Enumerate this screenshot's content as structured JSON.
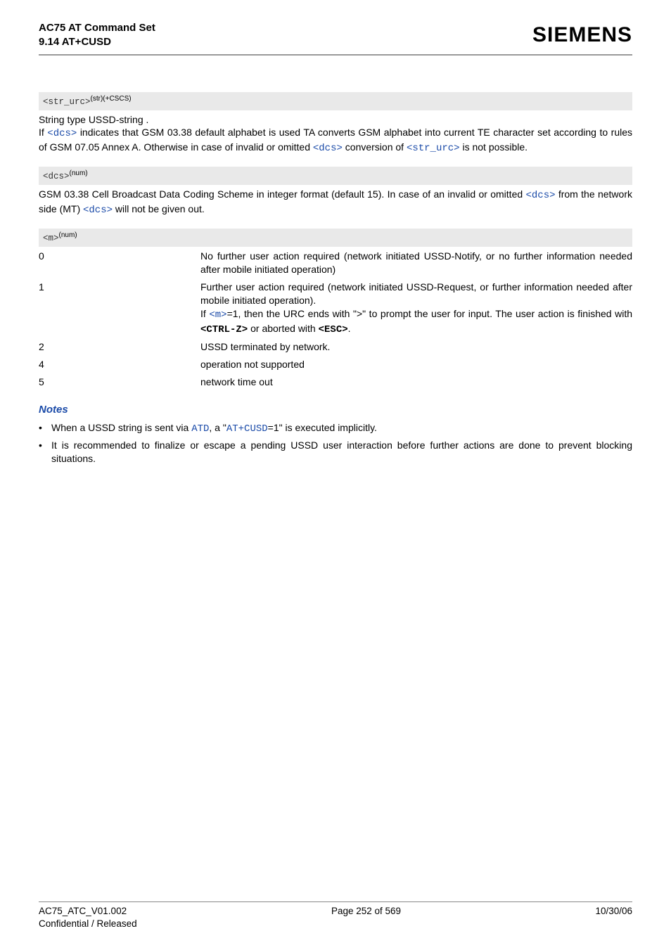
{
  "header": {
    "title_line1": "AC75 AT Command Set",
    "title_line2": "9.14 AT+CUSD",
    "brand": "SIEMENS"
  },
  "params": {
    "str_urc": {
      "code": "<str_urc>",
      "sup": "(str)(+CSCS)",
      "desc_pre": "String type USSD-string .",
      "desc_p1a": "If ",
      "dcs1": "<dcs>",
      "desc_p1b": " indicates that GSM 03.38 default alphabet is used TA converts GSM alphabet into current TE character set according to rules of GSM 07.05 Annex A. Otherwise in case of invalid or omitted ",
      "dcs2": "<dcs>",
      "desc_p1c": " conversion of ",
      "str_urc_ref": "<str_urc>",
      "desc_p1d": " is not possible."
    },
    "dcs": {
      "code": "<dcs>",
      "sup": "(num)",
      "desc_a": "GSM 03.38 Cell Broadcast Data Coding Scheme in integer format (default 15). In case of an invalid or omitted ",
      "dcs1": "<dcs>",
      "desc_b": " from the network side (MT) ",
      "dcs2": "<dcs>",
      "desc_c": " will not be given out."
    },
    "m": {
      "code": "<m>",
      "sup": "(num)",
      "rows": [
        {
          "key": "0",
          "val": "No further user action required (network initiated USSD-Notify, or no further information needed after mobile initiated operation)"
        },
        {
          "key": "1",
          "val_a": "Further user action required (network initiated USSD-Request, or further information needed after mobile initiated operation).",
          "val_b_pre": "If ",
          "m_ref": "<m>",
          "val_b_post": "=1, then the URC ends with \">\" to prompt the user for input. The user action is finished with ",
          "ctrlz": "<CTRL-Z>",
          "val_b_mid": " or aborted with ",
          "esc": "<ESC>",
          "val_b_end": "."
        },
        {
          "key": "2",
          "val": "USSD terminated by network."
        },
        {
          "key": "4",
          "val": "operation not supported"
        },
        {
          "key": "5",
          "val": "network time out"
        }
      ]
    }
  },
  "notes": {
    "heading": "Notes",
    "n1_a": "When a USSD string is sent via ",
    "atd": "ATD",
    "n1_b": ", a \"",
    "atcusd": "AT+CUSD",
    "n1_c": "=1\" is executed implicitly.",
    "n2": "It is recommended to finalize or escape a pending USSD user interaction before further actions are done to prevent blocking situations."
  },
  "footer": {
    "left1": "AC75_ATC_V01.002",
    "left2": "Confidential / Released",
    "center": "Page 252 of 569",
    "right": "10/30/06"
  }
}
